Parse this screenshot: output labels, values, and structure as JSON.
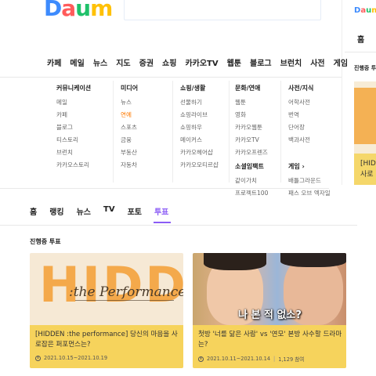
{
  "header": {
    "logo": [
      "D",
      "a",
      "u",
      "m"
    ]
  },
  "main_nav": [
    "카페",
    "메일",
    "뉴스",
    "지도",
    "증권",
    "쇼핑",
    "카카오TV",
    "웹툰",
    "블로그",
    "브런치",
    "사전",
    "게임"
  ],
  "dropdown": {
    "columns": [
      {
        "heading": "커뮤니케이션",
        "items": [
          "메일",
          "카페",
          "블로그",
          "티스토리",
          "브런치",
          "카카오스토리"
        ]
      },
      {
        "heading": "미디어",
        "items": [
          "뉴스",
          "연예",
          "스포츠",
          "금융",
          "부동산",
          "자동차"
        ],
        "active": "연예"
      },
      {
        "heading": "쇼핑/생활",
        "items": [
          "선물하기",
          "쇼핑라이브",
          "쇼핑하우",
          "메이커스",
          "카카오헤어샵",
          "카카오모티르샵"
        ]
      },
      {
        "heading": "문화/연애",
        "items": [
          "웹툰",
          "영화",
          "카카오웹툰",
          "카카오TV",
          "카카오프렌즈"
        ]
      },
      {
        "heading": "사전/지식",
        "items": [
          "어학사전",
          "번역",
          "단어장",
          "백과사전"
        ]
      }
    ],
    "extra": {
      "social_heading": "소셜임팩트",
      "social_items": [
        "같이가치",
        "프로젝트100"
      ],
      "game_heading": "게임 ›",
      "game_items": [
        "배틀그라운드",
        "패스 오브 엑자일"
      ]
    }
  },
  "right_panel": {
    "home": "홈",
    "section": "진행중 투",
    "card_text": [
      "[HID",
      "사로"
    ]
  },
  "tabs": [
    "홈",
    "랭킹",
    "뉴스",
    "TV",
    "포토",
    "투표"
  ],
  "active_tab": "투표",
  "section_title": "진행중 투표",
  "cards": [
    {
      "thumb_title": "HIDDEN",
      "thumb_sub": ":the Performance",
      "title": "[HIDDEN :the performance] 당신의 마음을 사로잡은 퍼포먼스는?",
      "date": "2021.10.15~2021.10.19",
      "participants": ""
    },
    {
      "thumb_sub": "나 본 적 없소?",
      "title": "첫방 '너를 닮은 사람' vs '연모' 본방 사수할 드라마는?",
      "date": "2021.10.11~2021.10.14",
      "participants": "1,129 참여"
    }
  ],
  "colors": {
    "accent_purple": "#8b5cf6",
    "active_orange": "#ff7a00",
    "card_yellow": "#f6d35c"
  }
}
